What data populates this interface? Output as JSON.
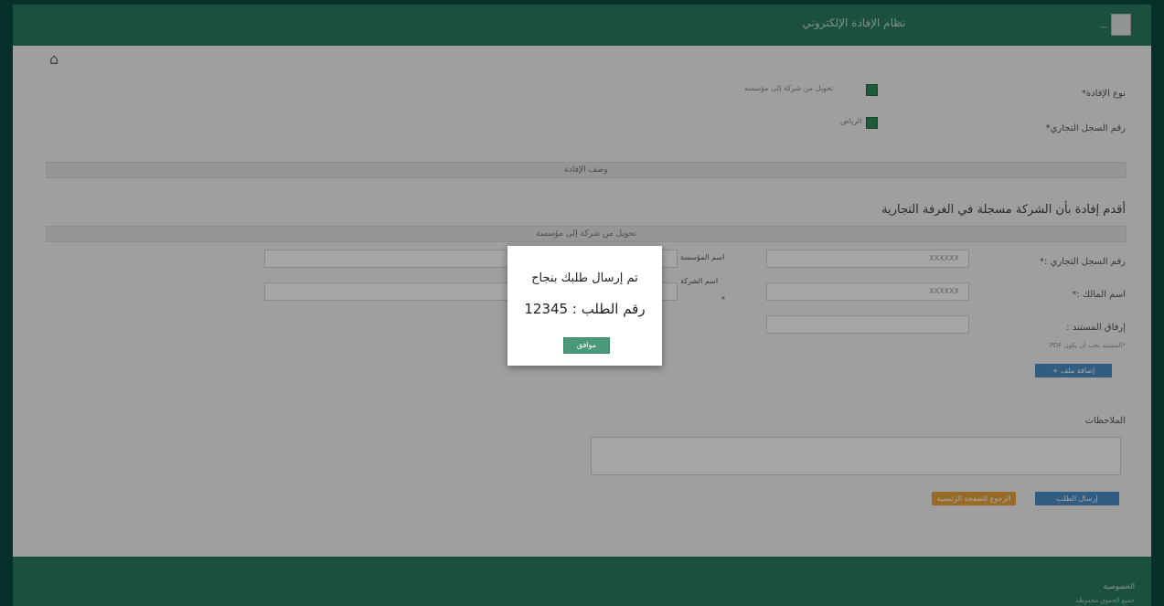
{
  "header": {
    "app_title": "نظام الإفادة الإلكتروني",
    "logo_text": "—"
  },
  "form": {
    "type_label": "نوع الإفادة*",
    "type_option": "تحويل من شركة إلى مؤسسة",
    "cr_label": "رقم السجل التجاري*",
    "cr_option": "الرياض",
    "band_title": "وصف الإفادة",
    "heading": "أقدم إفادة بأن الشركة مسجلة في الغرفة التجارية",
    "band_sub": "تحويل من شركة إلى مؤسسة",
    "cr_number_label": "رقم السجل التجاري :*",
    "cr_number_value": "XXXXXX",
    "owner_label": "اسم المالك :*",
    "owner_value": "XXXXXX",
    "attach_label": "إرفاق المستند :",
    "attach_note": "*المستند يجب أن يكون PDF",
    "add_file_btn": "+ إضافة ملف",
    "est_name_label": "اسم المؤسسة",
    "company_name_label": "اسم الشركة",
    "asterisk": "*",
    "notes_label": "الملاحظات",
    "submit_btn": "إرسال الطلب",
    "back_btn": "الرجوع للصفحة الرئيسية"
  },
  "footer": {
    "link": "الخصوصية",
    "copyright": "جميع الحقوق محفوظة"
  },
  "modal": {
    "message": "تم إرسال طلبك بنجاح",
    "request_label": "رقم الطلب :",
    "request_number": "12345",
    "ok_button": "موافق"
  },
  "colors": {
    "header": "#2a7a60",
    "accent_green": "#2e8b57",
    "button_blue": "#4a8fc6",
    "button_orange": "#e8a53b"
  },
  "icons": {
    "home": "home-icon",
    "plus": "plus-icon"
  }
}
